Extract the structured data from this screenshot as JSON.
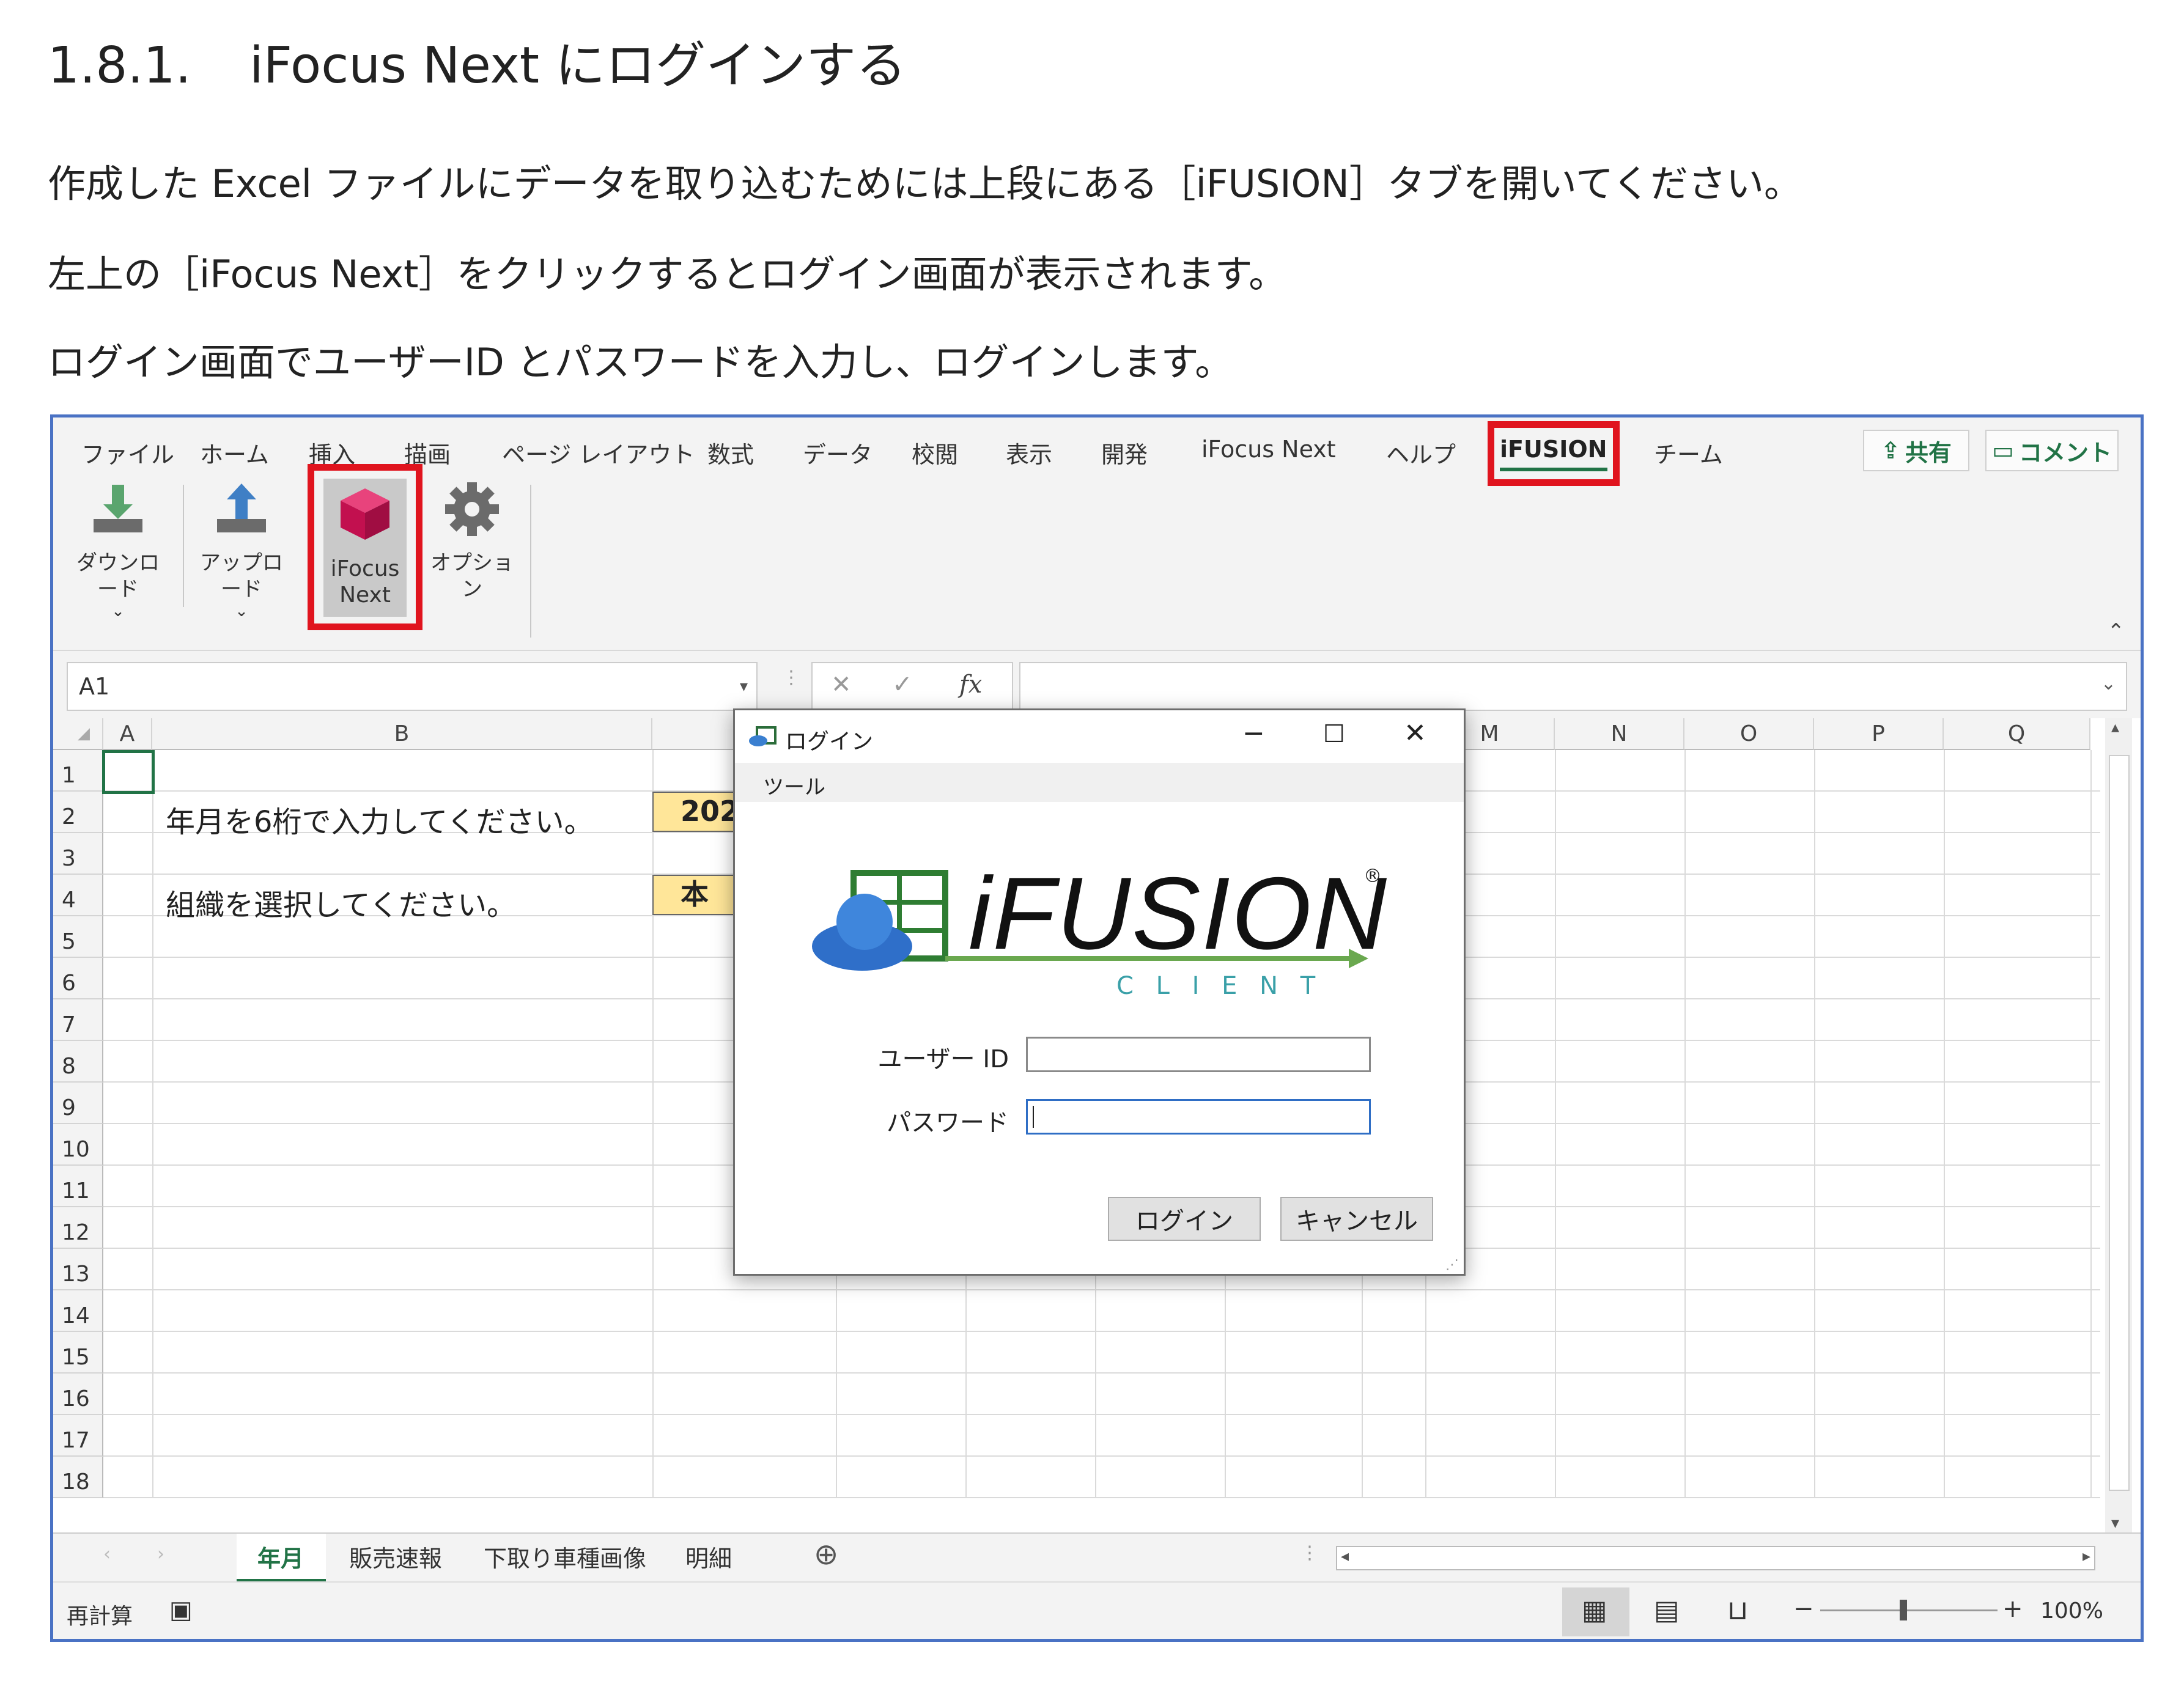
{
  "heading": {
    "number": "1.8.1.",
    "title": "iFocus Next にログインする"
  },
  "paragraphs": [
    "作成した Excel ファイルにデータを取り込むためには上段にある［iFUSION］タブを開いてください。",
    "左上の［iFocus Next］をクリックするとログイン画面が表示されます。",
    "ログイン画面でユーザーID とパスワードを入力し、ログインします。"
  ],
  "excel": {
    "tabs": [
      "ファイル",
      "ホーム",
      "挿入",
      "描画",
      "ページ レイアウト",
      "数式",
      "データ",
      "校閲",
      "表示",
      "開発",
      "iFocus Next",
      "ヘルプ",
      "iFUSION",
      "チーム"
    ],
    "share_label": "共有",
    "comment_label": "コメント",
    "ribbon_buttons": {
      "download": "ダウンロード",
      "upload": "アップロード",
      "ifocus_line1": "iFocus",
      "ifocus_line2": "Next",
      "options": "オプション"
    },
    "name_box": "A1",
    "fx": "fx",
    "columns_left": [
      "A",
      "B"
    ],
    "columns_right": [
      "M",
      "N",
      "O",
      "P",
      "Q"
    ],
    "rows": [
      "1",
      "2",
      "3",
      "4",
      "5",
      "6",
      "7",
      "8",
      "9",
      "10",
      "11",
      "12",
      "13",
      "14",
      "15",
      "16",
      "17",
      "18"
    ],
    "cells": {
      "b2": "年月を6桁で入力してください。",
      "b4": "組織を選択してください。",
      "c2": "202",
      "c4": "本"
    },
    "sheet_tabs": [
      "年月",
      "販売速報",
      "下取り車種画像",
      "明細"
    ],
    "status": {
      "recalc": "再計算",
      "zoom": "100%"
    }
  },
  "login": {
    "title": "ログイン",
    "menu": "ツール",
    "logo_text": "iFUSION",
    "logo_sub": "C L I E N T",
    "user_label": "ユーザー ID",
    "password_label": "パスワード",
    "login_button": "ログイン",
    "cancel_button": "キャンセル"
  }
}
